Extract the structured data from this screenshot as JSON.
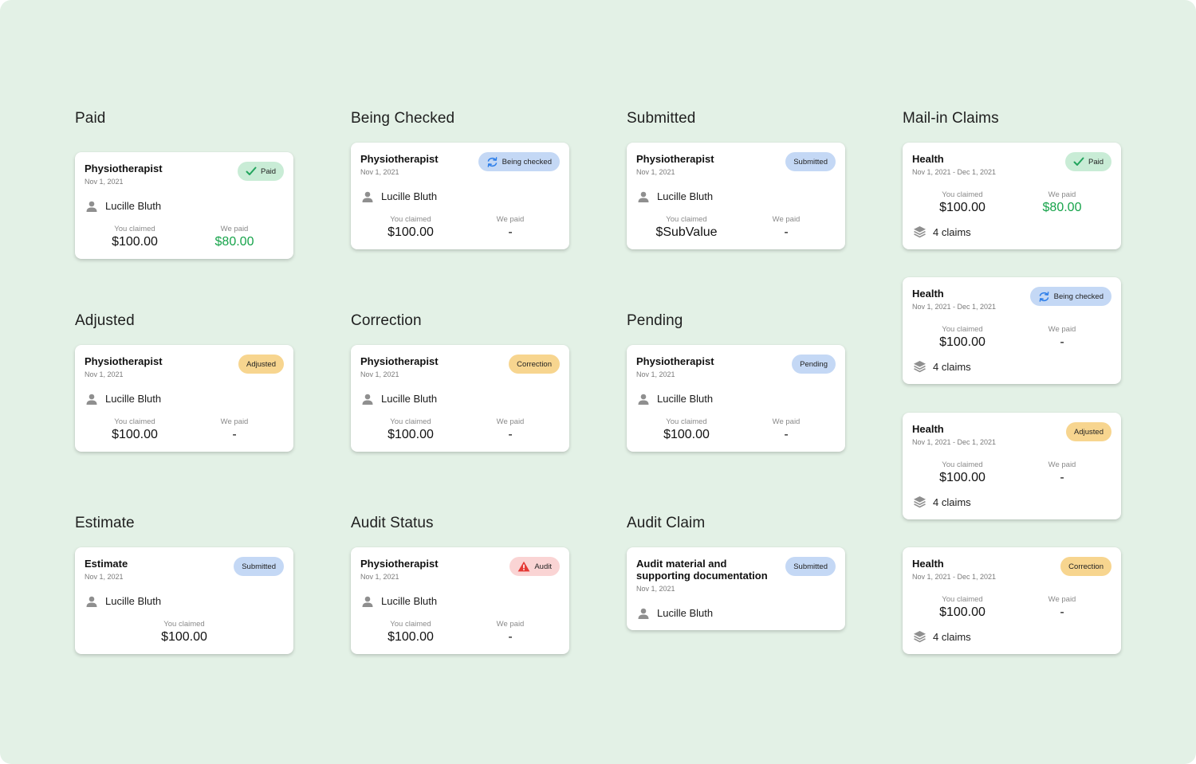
{
  "columns": [
    {
      "title": "Paid",
      "card": {
        "title": "Physiotherapist",
        "date": "Nov 1, 2021",
        "badge": "Paid",
        "person": "Lucille Bluth",
        "claimed_label": "You claimed",
        "claimed": "$100.00",
        "paid_label": "We paid",
        "paid": "$80.00"
      }
    },
    {
      "title": "Being Checked",
      "card": {
        "title": "Physiotherapist",
        "date": "Nov 1, 2021",
        "badge": "Being checked",
        "person": "Lucille Bluth",
        "claimed_label": "You claimed",
        "claimed": "$100.00",
        "paid_label": "We paid",
        "paid": "-"
      }
    },
    {
      "title": "Submitted",
      "card": {
        "title": "Physiotherapist",
        "date": "Nov 1, 2021",
        "badge": "Submitted",
        "person": "Lucille Bluth",
        "claimed_label": "You claimed",
        "claimed": "$SubValue",
        "paid_label": "We paid",
        "paid": "-"
      }
    },
    {
      "title": "Adjusted",
      "card": {
        "title": "Physiotherapist",
        "date": "Nov 1, 2021",
        "badge": "Adjusted",
        "person": "Lucille Bluth",
        "claimed_label": "You claimed",
        "claimed": "$100.00",
        "paid_label": "We paid",
        "paid": "-"
      }
    },
    {
      "title": "Correction",
      "card": {
        "title": "Physiotherapist",
        "date": "Nov 1, 2021",
        "badge": "Correction",
        "person": "Lucille Bluth",
        "claimed_label": "You claimed",
        "claimed": "$100.00",
        "paid_label": "We paid",
        "paid": "-"
      }
    },
    {
      "title": "Pending",
      "card": {
        "title": "Physiotherapist",
        "date": "Nov 1, 2021",
        "badge": "Pending",
        "person": "Lucille Bluth",
        "claimed_label": "You claimed",
        "claimed": "$100.00",
        "paid_label": "We paid",
        "paid": "-"
      }
    },
    {
      "title": "Estimate",
      "card": {
        "title": "Estimate",
        "date": "Nov 1, 2021",
        "badge": "Submitted",
        "person": "Lucille Bluth",
        "claimed_label": "You claimed",
        "claimed": "$100.00"
      }
    },
    {
      "title": "Audit Status",
      "card": {
        "title": "Physiotherapist",
        "date": "Nov 1, 2021",
        "badge": "Audit",
        "person": "Lucille Bluth",
        "claimed_label": "You claimed",
        "claimed": "$100.00",
        "paid_label": "We paid",
        "paid": "-"
      }
    },
    {
      "title": "Audit Claim",
      "card": {
        "title": "Audit material and supporting documentation",
        "date": "Nov 1, 2021",
        "badge": "Submitted",
        "person": "Lucille Bluth"
      }
    }
  ],
  "mail_in": {
    "title": "Mail-in Claims",
    "cards": [
      {
        "title": "Health",
        "date": "Nov 1, 2021 - Dec 1, 2021",
        "badge": "Paid",
        "claimed_label": "You claimed",
        "claimed": "$100.00",
        "paid_label": "We paid",
        "paid": "$80.00",
        "claims": "4 claims"
      },
      {
        "title": "Health",
        "date": "Nov 1, 2021 - Dec 1, 2021",
        "badge": "Being checked",
        "claimed_label": "You claimed",
        "claimed": "$100.00",
        "paid_label": "We paid",
        "paid": "-",
        "claims": "4 claims"
      },
      {
        "title": "Health",
        "date": "Nov 1, 2021 - Dec 1, 2021",
        "badge": "Adjusted",
        "claimed_label": "You claimed",
        "claimed": "$100.00",
        "paid_label": "We paid",
        "paid": "-",
        "claims": "4 claims"
      },
      {
        "title": "Health",
        "date": "Nov 1, 2021 - Dec 1, 2021",
        "badge": "Correction",
        "claimed_label": "You claimed",
        "claimed": "$100.00",
        "paid_label": "We paid",
        "paid": "-",
        "claims": "4 claims"
      }
    ]
  },
  "icons": {
    "paid": "check-icon",
    "being_checked": "refresh-icon",
    "audit": "warning-icon",
    "person": "person-icon",
    "claims": "layers-icon"
  },
  "colors": {
    "background": "#e3f1e6",
    "paid_green": "#16a34a",
    "badge_green": "#c9ecd6",
    "badge_blue": "#c4d8f5",
    "badge_yellow": "#f7d58f",
    "badge_red": "#fad4d4",
    "check_green": "#22a45d",
    "refresh_blue": "#2b7de9",
    "warning_red": "#e53935"
  }
}
